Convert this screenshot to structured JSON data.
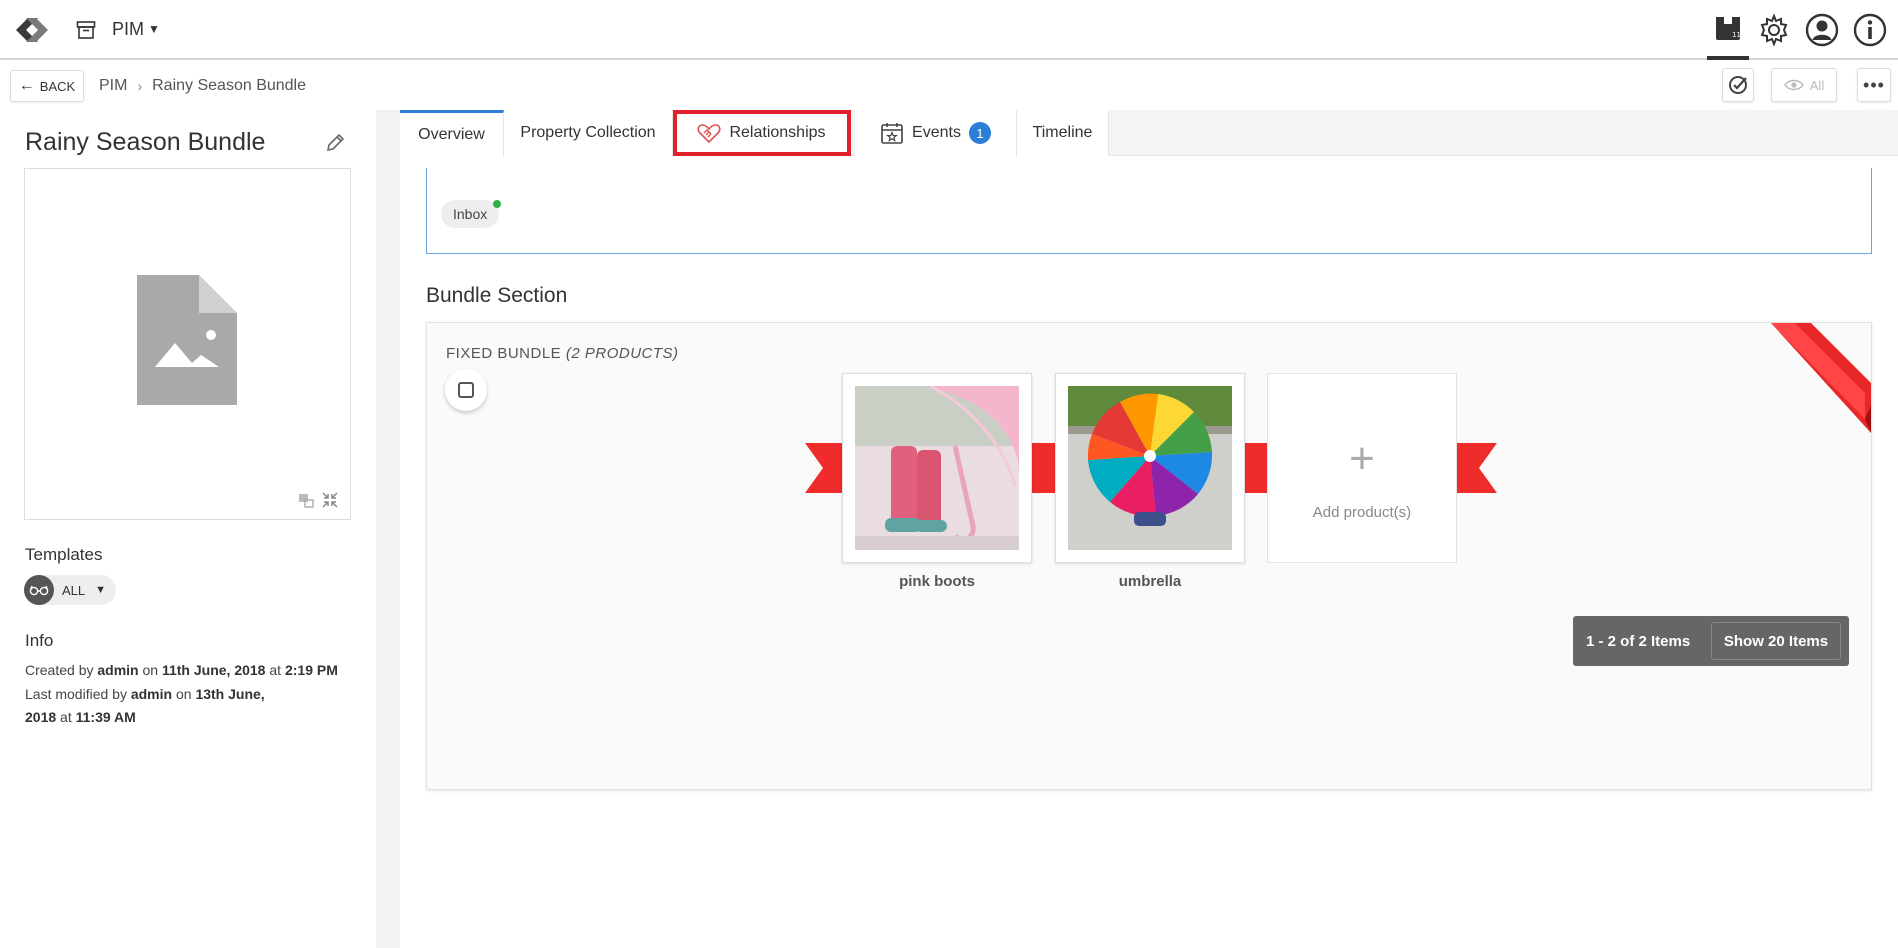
{
  "header": {
    "app_name": "PIM",
    "icons": [
      "app-logo-icon",
      "archive-icon",
      "caret-down-icon",
      "bundle-icon",
      "gear-icon",
      "user-icon",
      "info-icon"
    ]
  },
  "subbar": {
    "back_label": "BACK",
    "breadcrumb": [
      "PIM",
      "Rainy Season Bundle"
    ],
    "view_all_label": "All"
  },
  "left": {
    "title": "Rainy Season Bundle",
    "templates_label": "Templates",
    "template_value": "ALL",
    "info_label": "Info",
    "created_prefix": "Created by",
    "created_by": "admin",
    "created_on_word": "on",
    "created_date": "11th June, 2018",
    "created_at_word": "at",
    "created_time": "2:19 PM",
    "modified_prefix": "Last modified by",
    "modified_by": "admin",
    "modified_on_word": "on",
    "modified_date_a": "13th June,",
    "modified_date_b": "2018",
    "modified_at_word": "at",
    "modified_time": "11:39 AM"
  },
  "tabs": [
    {
      "label": "Overview",
      "active": true
    },
    {
      "label": "Property Collection"
    },
    {
      "label": "Relationships",
      "highlight": true
    },
    {
      "label": "Events",
      "badge": "1"
    },
    {
      "label": "Timeline"
    }
  ],
  "overview": {
    "inbox_chip": "Inbox",
    "bundle_section_title": "Bundle Section",
    "bundle_label": "FIXED BUNDLE",
    "bundle_count": "(2 PRODUCTS)",
    "products": [
      {
        "name": "pink boots"
      },
      {
        "name": "umbrella"
      }
    ],
    "add_product_label": "Add product(s)",
    "pager_count": "1 - 2 of 2 Items",
    "pager_show": "Show 20 Items"
  },
  "colors": {
    "accent": "#2b7fd6",
    "ribbon": "#f02b2b",
    "highlight_border": "#e0202a",
    "status_dot": "#29b34a"
  }
}
